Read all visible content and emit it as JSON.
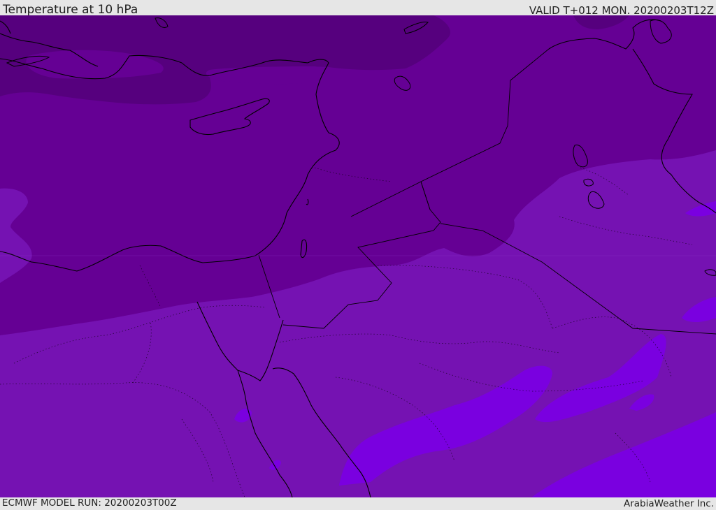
{
  "header": {
    "title": "Temperature at 10 hPa",
    "valid": "VALID T+012 MON. 20200203T12Z"
  },
  "footer": {
    "model_run": "ECMWF MODEL RUN: 20200203T00Z",
    "credit": "ArabiaWeather Inc."
  },
  "map": {
    "variable": "temperature",
    "level": "10 hPa",
    "colors": {
      "band_darkest": "#56007e",
      "band_dark": "#650094",
      "band_mid": "#7512b2",
      "band_light": "#7a00e0",
      "coastline": "#000000"
    }
  }
}
